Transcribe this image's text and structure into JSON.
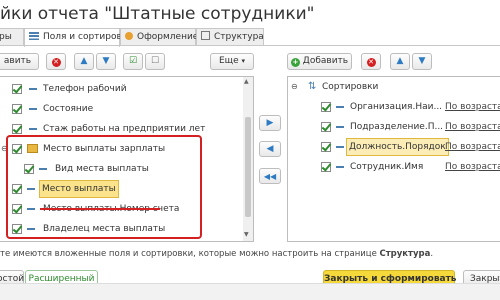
{
  "window": {
    "title": "йки отчета \"Штатные сотрудники\""
  },
  "tabs": [
    {
      "label": "ры"
    },
    {
      "label": "Поля и сортировки"
    },
    {
      "label": "Оформление"
    },
    {
      "label": "Структура"
    }
  ],
  "left_toolbar": {
    "add_label": "авить",
    "more_label": "Еще"
  },
  "right_toolbar": {
    "add_label": "Добавить"
  },
  "fields_tree": {
    "items": [
      {
        "label": "Телефон рабочий"
      },
      {
        "label": "Состояние"
      },
      {
        "label": "Стаж работы на предприятии лет"
      },
      {
        "label": "Место выплаты зарплаты"
      },
      {
        "label": "Вид места выплаты"
      },
      {
        "label": "Место выплаты"
      },
      {
        "label": "Место выплаты.Номер счета"
      },
      {
        "label": "Владелец места выплаты"
      }
    ]
  },
  "sorting_tree": {
    "root": "Сортировки",
    "items": [
      {
        "field": "Организация.Наи...",
        "order": "По возрастан"
      },
      {
        "field": "Подразделение.П...",
        "order": "По возрастан"
      },
      {
        "field": "Должность.Порядок",
        "order": "По возрастан"
      },
      {
        "field": "Сотрудник.Имя",
        "order": "По возрастан"
      }
    ]
  },
  "hint": {
    "prefix": "те имеются вложенные поля и сортировки, которые можно настроить на странице ",
    "link": "Структура",
    "suffix": "."
  },
  "bottom_bar": {
    "simple_label": "остой",
    "advanced_label": "Расширенный",
    "close_generate_label": "Закрыть и сформировать",
    "close_label": "Закрыт"
  },
  "colors": {
    "accent_yellow": "#f5d93a",
    "highlight_red": "#d42020",
    "tab_orange": "#e8a030"
  }
}
